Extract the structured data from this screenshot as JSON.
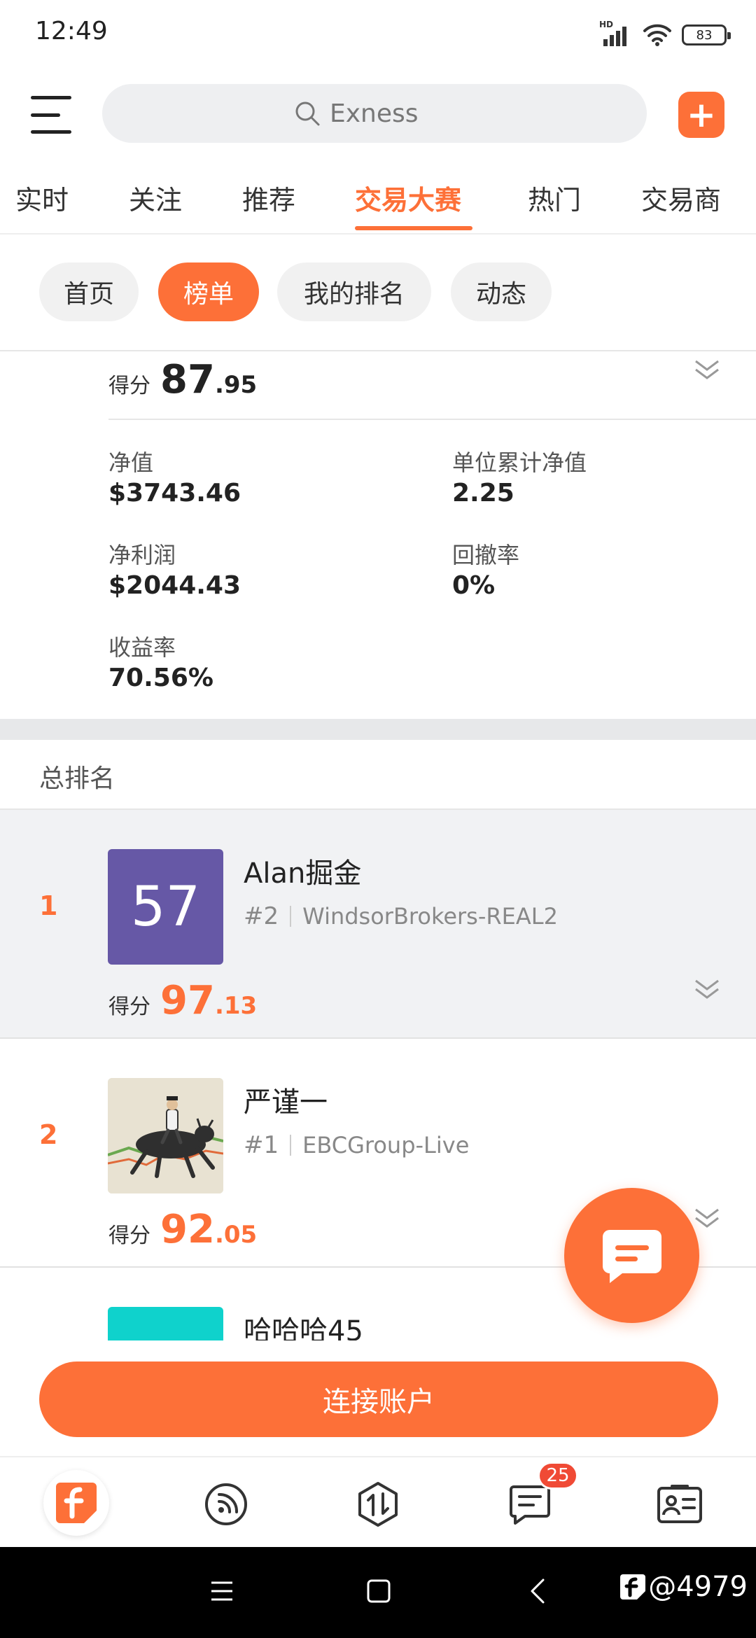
{
  "status_bar": {
    "time": "12:49",
    "hd": "HD",
    "battery": "83"
  },
  "search": {
    "placeholder": "Exness"
  },
  "main_tabs": [
    "实时",
    "关注",
    "推荐",
    "交易大赛",
    "热门",
    "交易商"
  ],
  "sub_tabs": [
    "首页",
    "榜单",
    "我的排名",
    "动态"
  ],
  "my_entry": {
    "score_label": "得分",
    "score_int": "87",
    "score_dec": ".95",
    "stats": [
      {
        "label": "净值",
        "value": "$3743.46"
      },
      {
        "label": "单位累计净值",
        "value": "2.25"
      },
      {
        "label": "净利润",
        "value": "$2044.43"
      },
      {
        "label": "回撤率",
        "value": "0%"
      },
      {
        "label": "收益率",
        "value": "70.56%"
      }
    ]
  },
  "section_title": "总排名",
  "rankings": [
    {
      "rank": "1",
      "avatar_text": "57",
      "name": "Alan掘金",
      "broker_rank": "#2",
      "broker": "WindsorBrokers-REAL2",
      "score_label": "得分",
      "score_int": "97",
      "score_dec": ".13"
    },
    {
      "rank": "2",
      "name": "严谨一",
      "broker_rank": "#1",
      "broker": "EBCGroup-Live",
      "score_label": "得分",
      "score_int": "92",
      "score_dec": ".05"
    },
    {
      "name": "哈哈哈45"
    }
  ],
  "connect_button": "连接账户",
  "bottom_nav": {
    "messages_badge": "25"
  },
  "watermark": "@4979",
  "colors": {
    "accent": "#fd7038",
    "avatar_purple": "#6658a6",
    "avatar_teal": "#0fd2cc"
  }
}
